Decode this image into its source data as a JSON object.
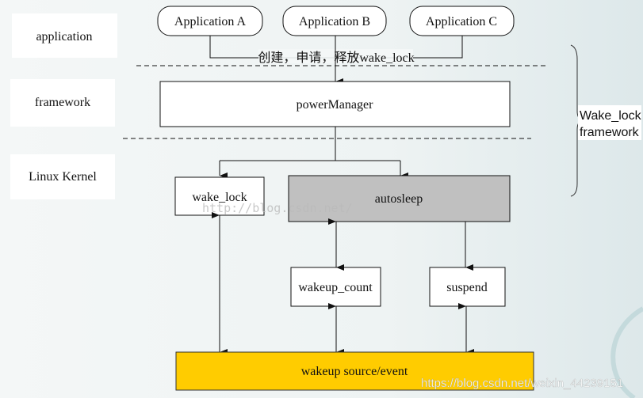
{
  "layers": {
    "application": "application",
    "framework": "framework",
    "kernel": "Linux Kernel"
  },
  "apps": [
    "Application A",
    "Application B",
    "Application C"
  ],
  "edge_label": "创建，申请，释放wake_lock",
  "nodes": {
    "power_manager": "powerManager",
    "wake_lock": "wake_lock",
    "autosleep": "autosleep",
    "wakeup_count": "wakeup_count",
    "suspend": "suspend",
    "wakeup_source": "wakeup source/event"
  },
  "brace_label": [
    "Wake_lock",
    "framework"
  ],
  "watermarks": {
    "faint": "http://blog.csdn.net/",
    "main": "https://blog.csdn.net/weixin_44239151"
  },
  "colors": {
    "autosleep_fill": "#c0c0c0",
    "wakeup_source_fill": "#ffcc00",
    "line": "#111111"
  }
}
